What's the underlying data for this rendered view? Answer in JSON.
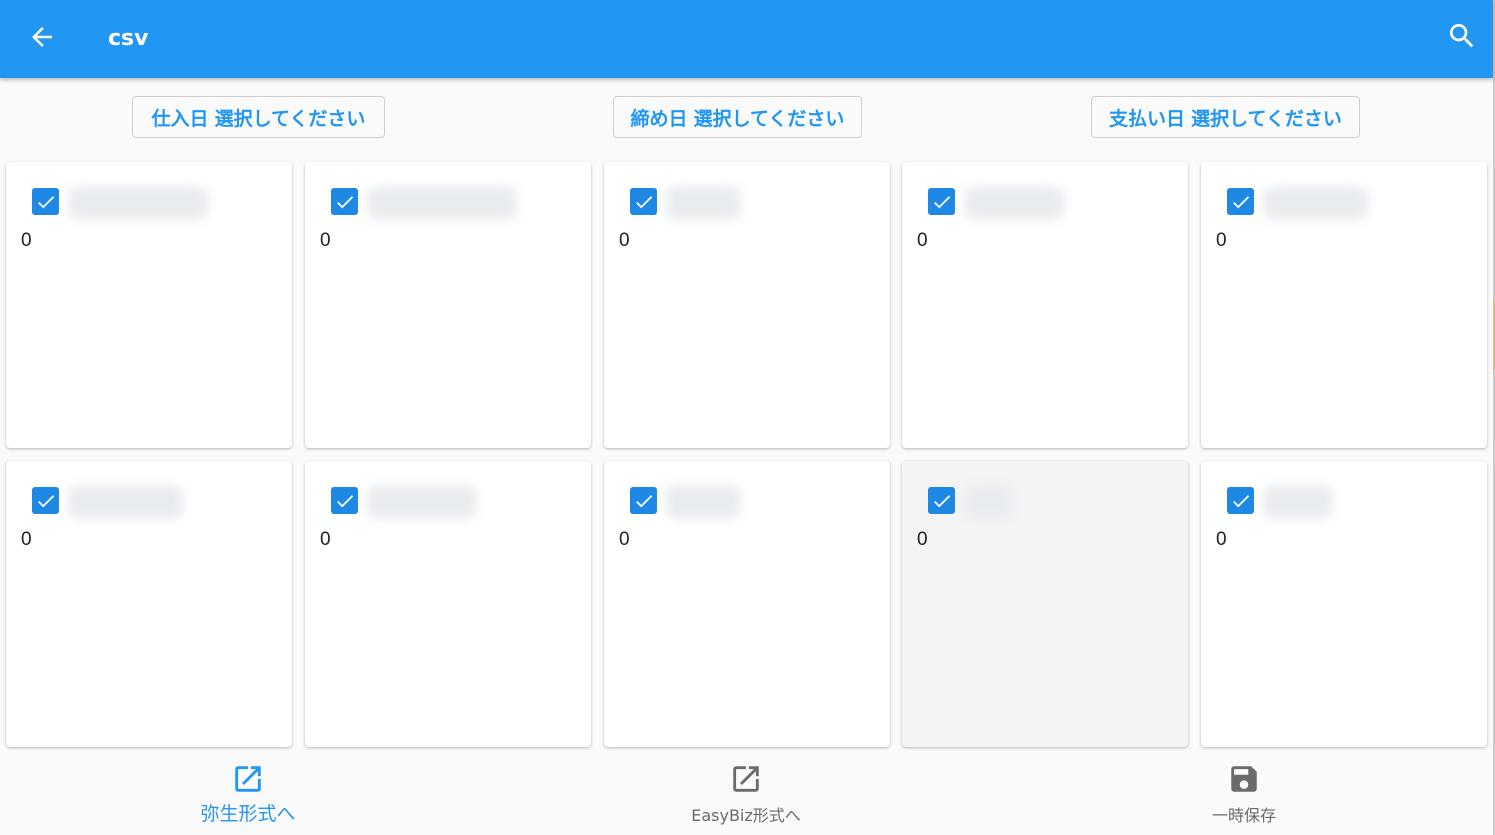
{
  "appbar": {
    "title": "csv",
    "back_icon": "arrow-back-icon",
    "search_icon": "search-icon",
    "color": "#2196f3"
  },
  "date_filters": [
    {
      "label": "仕入日",
      "value": "選択してください"
    },
    {
      "label": "締め日",
      "value": "選択してください"
    },
    {
      "label": "支払い日",
      "value": "選択してください"
    }
  ],
  "cards": [
    {
      "checked": true,
      "count": "0"
    },
    {
      "checked": true,
      "count": "0"
    },
    {
      "checked": true,
      "count": "0"
    },
    {
      "checked": true,
      "count": "0"
    },
    {
      "checked": true,
      "count": "0"
    },
    {
      "checked": true,
      "count": "0"
    },
    {
      "checked": true,
      "count": "0"
    },
    {
      "checked": true,
      "count": "0"
    },
    {
      "checked": true,
      "count": "0",
      "highlighted": true
    },
    {
      "checked": true,
      "count": "0"
    }
  ],
  "bottom_nav": [
    {
      "label": "弥生形式へ",
      "icon": "open-in-new-icon",
      "active": true
    },
    {
      "label": "EasyBiz形式へ",
      "icon": "open-in-new-icon",
      "active": false
    },
    {
      "label": "一時保存",
      "icon": "save-icon",
      "active": false
    }
  ],
  "colors": {
    "accent": "#2196f3",
    "checkbox": "#1e88e5",
    "inactive": "#6b6b6b"
  }
}
